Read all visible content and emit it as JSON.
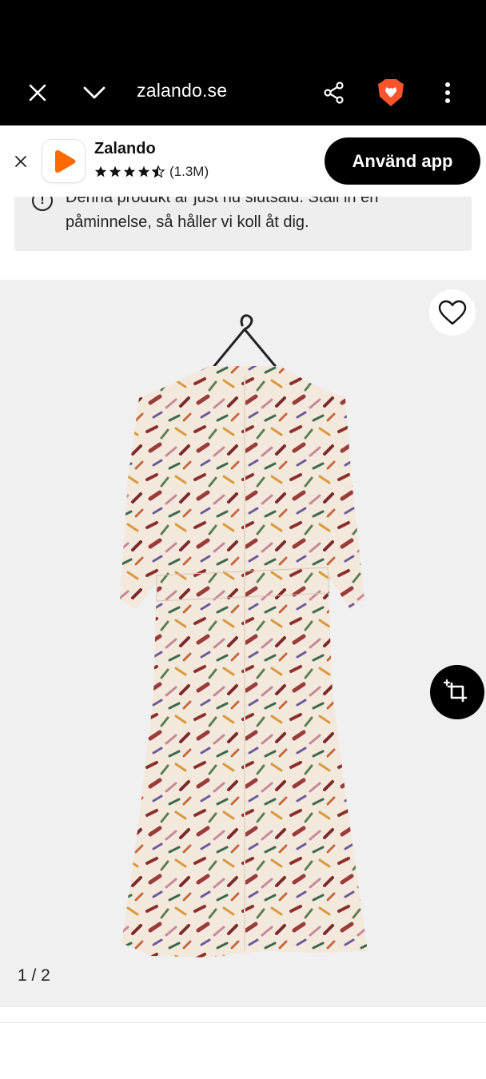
{
  "browser": {
    "url": "zalando.se",
    "icons": [
      "close-icon",
      "chevron-down-icon",
      "share-icon",
      "brave-lion-icon",
      "more-vertical-icon"
    ]
  },
  "app_banner": {
    "app_name": "Zalando",
    "rating_stars": 4.5,
    "rating_count": "(1.3M)",
    "button_label": "Använd app",
    "brand_color": "#FF6900"
  },
  "notice": {
    "text": "Denna produkt är just nu slutsåld. Ställ in en påminnelse, så håller vi koll åt dig."
  },
  "gallery": {
    "counter": "1 / 2",
    "icons": [
      "heart-icon",
      "crop-share-icon"
    ]
  }
}
